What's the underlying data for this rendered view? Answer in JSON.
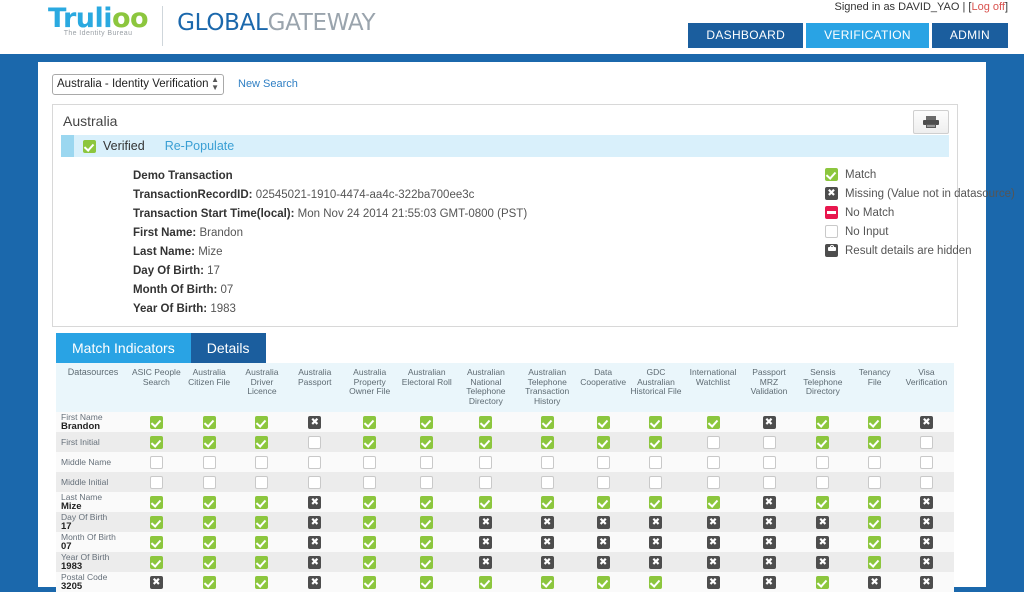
{
  "header": {
    "logo_main": "Truli",
    "logo_main_oo": "oo",
    "logo_tagline": "The Identity Bureau",
    "logo_gg_bold": "GLOBAL",
    "logo_gg_light": "GATEWAY",
    "signed_in_prefix": "Signed in as DAVID_YAO | [",
    "signed_in_logoff": "Log off",
    "signed_in_suffix": "]",
    "nav": [
      {
        "label": "DASHBOARD",
        "style": "dark"
      },
      {
        "label": "VERIFICATION",
        "style": "light"
      },
      {
        "label": "ADMIN",
        "style": "dark"
      }
    ]
  },
  "search": {
    "country_value": "Australia - Identity Verification",
    "new_search_label": "New Search"
  },
  "panel": {
    "title": "Australia",
    "verified_label": "Verified",
    "repopulate_label": "Re-Populate",
    "print_icon": "printer-icon"
  },
  "transaction": {
    "demo_label": "Demo Transaction",
    "record_id_label": "TransactionRecordID:",
    "record_id_value": "02545021-1910-4474-aa4c-322ba700ee3c",
    "start_time_label": "Transaction Start Time(local):",
    "start_time_value": "Mon Nov 24 2014 21:55:03 GMT-0800 (PST)",
    "first_name_label": "First Name:",
    "first_name_value": "Brandon",
    "last_name_label": "Last Name:",
    "last_name_value": "Mize",
    "day_label": "Day Of Birth:",
    "day_value": "17",
    "month_label": "Month Of Birth:",
    "month_value": "07",
    "year_label": "Year Of Birth:",
    "year_value": "1983"
  },
  "legend": [
    {
      "state": "match",
      "icon": "green-check-icon",
      "label": "Match"
    },
    {
      "state": "missing",
      "icon": "dark-x-icon",
      "label": "Missing (Value not in datasource)"
    },
    {
      "state": "nomatch",
      "icon": "red-dash-icon",
      "label": "No Match"
    },
    {
      "state": "noinput",
      "icon": "empty-box-icon",
      "label": "No Input"
    },
    {
      "state": "hidden",
      "icon": "lock-icon",
      "label": "Result details are hidden"
    }
  ],
  "tabs": [
    {
      "label": "Match Indicators",
      "active": true
    },
    {
      "label": "Details",
      "active": false
    }
  ],
  "table": {
    "columns": [
      "Datasources",
      "ASIC People Search",
      "Australia Citizen File",
      "Australia Driver Licence",
      "Australia Passport",
      "Australia Property Owner File",
      "Australian Electoral Roll",
      "Australian National Telephone Directory",
      "Australian Telephone Transaction History",
      "Data Cooperative",
      "GDC Australian Historical File",
      "International Watchlist",
      "Passport MRZ Validation",
      "Sensis Telephone Directory",
      "Tenancy File",
      "Visa Verification"
    ],
    "rows": [
      {
        "label": "First Name",
        "value": "Brandon",
        "cells": [
          "match",
          "match",
          "match",
          "missing",
          "match",
          "match",
          "match",
          "match",
          "match",
          "match",
          "match",
          "missing",
          "match",
          "match",
          "missing"
        ]
      },
      {
        "label": "First Initial",
        "value": "",
        "cells": [
          "match",
          "match",
          "match",
          "noinput",
          "match",
          "match",
          "match",
          "match",
          "match",
          "match",
          "noinput",
          "noinput",
          "match",
          "match",
          "noinput"
        ]
      },
      {
        "label": "Middle Name",
        "value": "",
        "cells": [
          "noinput",
          "noinput",
          "noinput",
          "noinput",
          "noinput",
          "noinput",
          "noinput",
          "noinput",
          "noinput",
          "noinput",
          "noinput",
          "noinput",
          "noinput",
          "noinput",
          "noinput"
        ]
      },
      {
        "label": "Middle Initial",
        "value": "",
        "cells": [
          "noinput",
          "noinput",
          "noinput",
          "noinput",
          "noinput",
          "noinput",
          "noinput",
          "noinput",
          "noinput",
          "noinput",
          "noinput",
          "noinput",
          "noinput",
          "noinput",
          "noinput"
        ]
      },
      {
        "label": "Last Name",
        "value": "Mize",
        "cells": [
          "match",
          "match",
          "match",
          "missing",
          "match",
          "match",
          "match",
          "match",
          "match",
          "match",
          "match",
          "missing",
          "match",
          "match",
          "missing"
        ]
      },
      {
        "label": "Day Of Birth",
        "value": "17",
        "cells": [
          "match",
          "match",
          "match",
          "missing",
          "match",
          "match",
          "missing",
          "missing",
          "missing",
          "missing",
          "missing",
          "missing",
          "missing",
          "match",
          "missing"
        ]
      },
      {
        "label": "Month Of Birth",
        "value": "07",
        "cells": [
          "match",
          "match",
          "match",
          "missing",
          "match",
          "match",
          "missing",
          "missing",
          "missing",
          "missing",
          "missing",
          "missing",
          "missing",
          "match",
          "missing"
        ]
      },
      {
        "label": "Year Of Birth",
        "value": "1983",
        "cells": [
          "match",
          "match",
          "match",
          "missing",
          "match",
          "match",
          "missing",
          "missing",
          "missing",
          "missing",
          "missing",
          "missing",
          "missing",
          "match",
          "missing"
        ]
      },
      {
        "label": "Postal Code",
        "value": "3205",
        "cells": [
          "missing",
          "match",
          "match",
          "missing",
          "match",
          "match",
          "match",
          "match",
          "match",
          "match",
          "missing",
          "missing",
          "match",
          "missing",
          "missing"
        ]
      }
    ]
  },
  "colors": {
    "brand_blue": "#1b68ac",
    "accent_blue": "#29a3e4",
    "match_green": "#8cc63e",
    "missing_dark": "#4d4d4d",
    "nomatch_red": "#e8174e"
  }
}
